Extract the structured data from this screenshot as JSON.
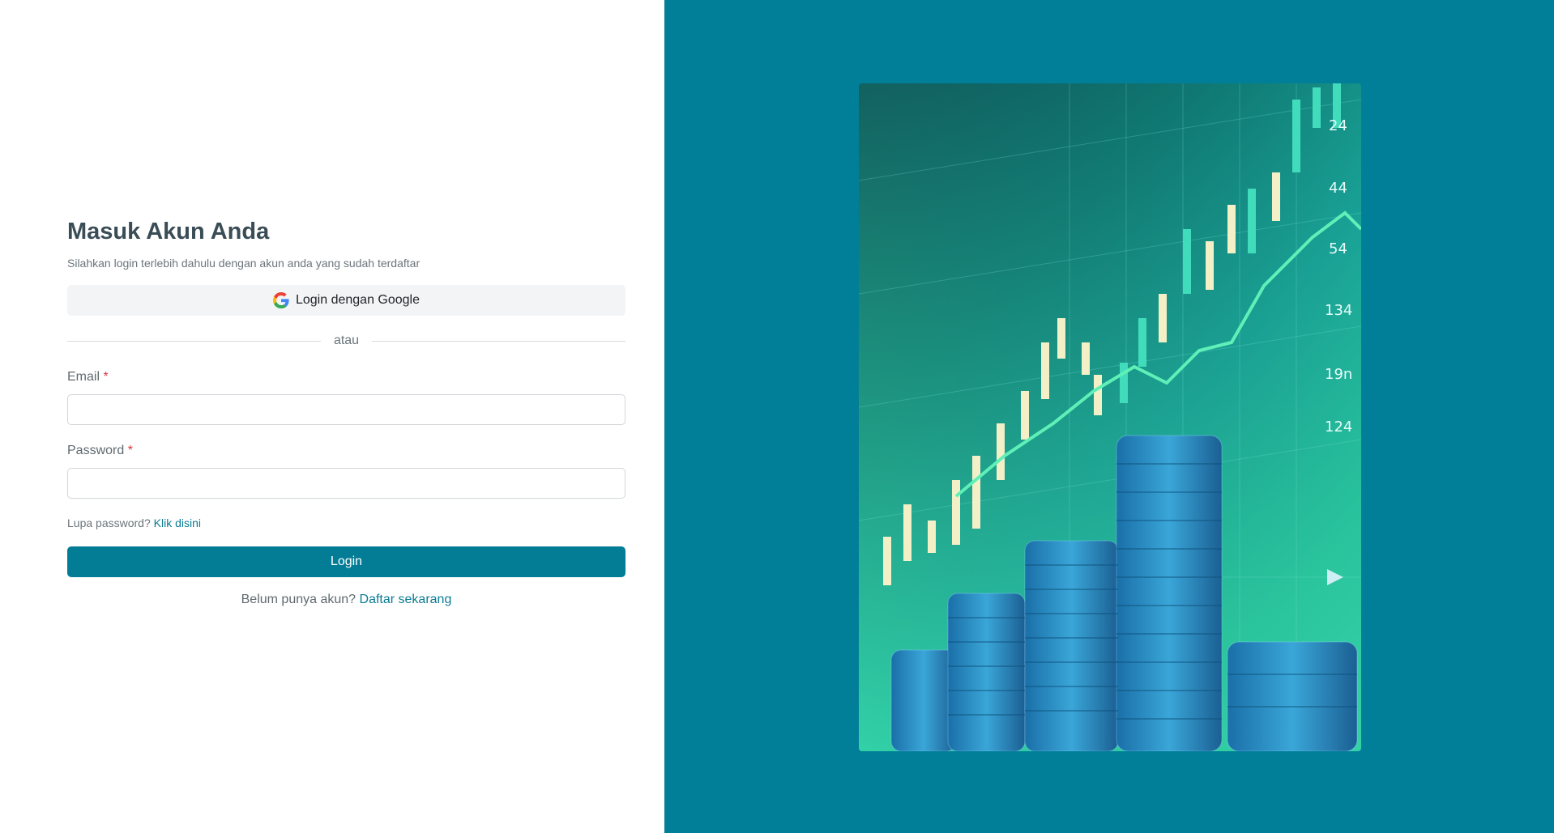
{
  "login": {
    "title": "Masuk Akun Anda",
    "subtitle": "Silahkan login terlebih dahulu dengan akun anda yang sudah terdaftar",
    "google_label": "Login dengan Google",
    "divider_text": "atau",
    "email_label": "Email",
    "password_label": "Password",
    "required_mark": "*",
    "forgot_text": "Lupa password?",
    "forgot_link": "Klik disini",
    "login_button": "Login",
    "register_text": "Belum punya akun?",
    "register_link": "Daftar sekarang",
    "email_value": "",
    "password_value": ""
  },
  "hero": {
    "tick_labels": [
      "24",
      "44",
      "54",
      "134",
      "19n",
      "124"
    ]
  },
  "colors": {
    "accent": "#037d95",
    "right_panel": "#017f99",
    "required": "#dc3545"
  },
  "icons": {
    "google": "google-icon"
  }
}
